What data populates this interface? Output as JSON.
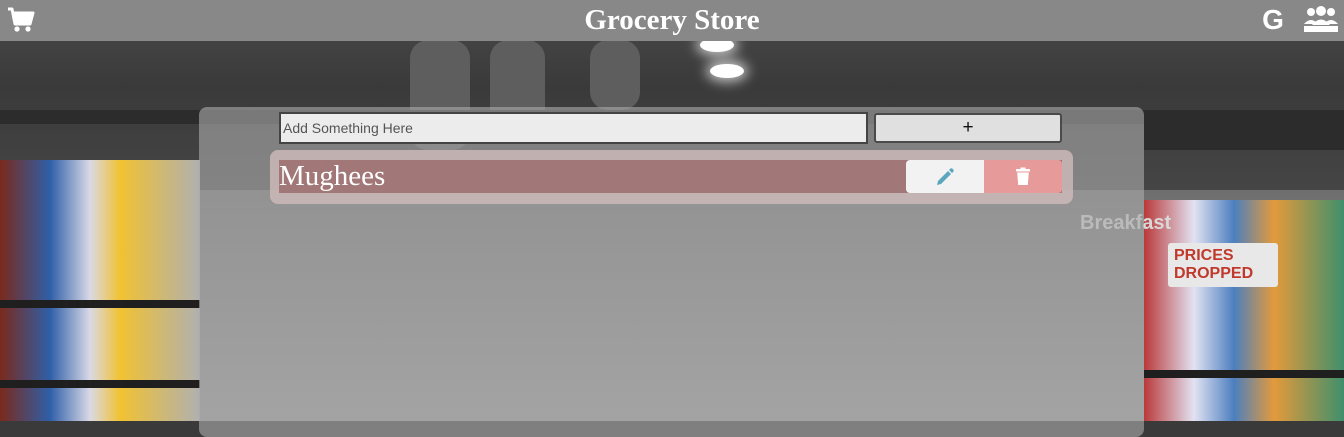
{
  "header": {
    "title": "Grocery Store",
    "google_label": "G",
    "cart_icon": "cart-icon",
    "users_icon": "users-icon",
    "background_color": "#888888"
  },
  "form": {
    "input_value": "",
    "input_placeholder": "Add Something Here",
    "add_button_label": "+"
  },
  "items": [
    {
      "name": "Mughees",
      "edit_icon": "pencil-icon",
      "delete_icon": "trash-icon"
    }
  ],
  "background": {
    "sign_breakfast": "Breakfast",
    "sign_prices": "PRICES DROPPED"
  },
  "colors": {
    "edit_button": "#f2f2f2",
    "edit_icon": "#5aa6bf",
    "delete_button": "#e79a9a",
    "item_row": "#966464"
  }
}
